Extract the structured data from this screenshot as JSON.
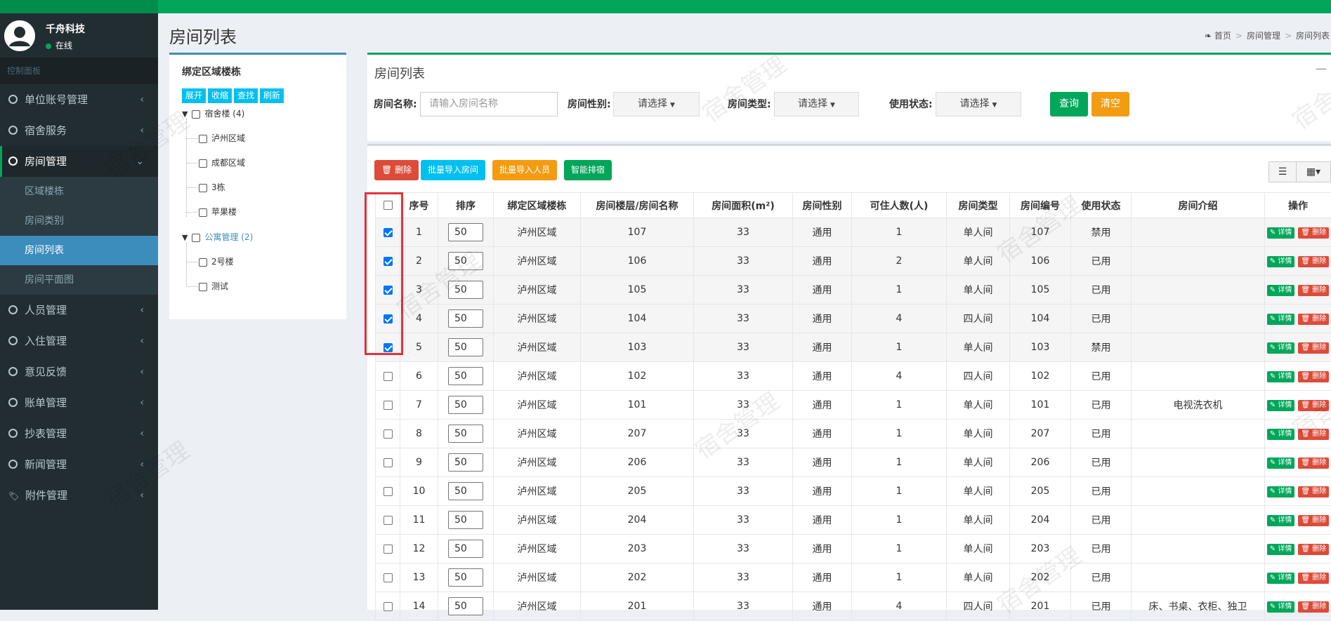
{
  "app": {
    "user_name": "千舟科技",
    "user_status": "在线"
  },
  "sidebar": {
    "header": "控制面板",
    "items": [
      {
        "label": "单位账号管理",
        "icon": "circle-icon",
        "active": false
      },
      {
        "label": "宿舍服务",
        "icon": "circle-icon",
        "active": false
      },
      {
        "label": "房间管理",
        "icon": "circle-icon",
        "active": true
      }
    ],
    "sub_items": [
      {
        "label": "区域楼栋",
        "active": false
      },
      {
        "label": "房间类别",
        "active": false
      },
      {
        "label": "房间列表",
        "active": true
      },
      {
        "label": "房间平面图",
        "active": false
      }
    ],
    "items_after": [
      {
        "label": "人员管理",
        "icon": "circle-icon"
      },
      {
        "label": "入住管理",
        "icon": "circle-icon"
      },
      {
        "label": "意见反馈",
        "icon": "circle-icon"
      },
      {
        "label": "账单管理",
        "icon": "circle-icon"
      },
      {
        "label": "抄表管理",
        "icon": "circle-icon"
      },
      {
        "label": "新闻管理",
        "icon": "circle-icon"
      },
      {
        "label": "附件管理",
        "icon": "tags-icon"
      }
    ]
  },
  "page": {
    "title": "房间列表"
  },
  "breadcrumb": {
    "home": "首页",
    "level1": "房间管理",
    "level2": "房间列表"
  },
  "tree": {
    "title": "绑定区域楼栋",
    "buttons": [
      "展开",
      "收缩",
      "查找",
      "刷新"
    ],
    "root1": "宿舍楼 (4)",
    "root1_children": [
      "泸州区域",
      "成都区域",
      "3栋",
      "苹果楼"
    ],
    "root2": "公寓管理 (2)",
    "root2_children": [
      "2号楼",
      "测试"
    ]
  },
  "filter": {
    "title": "房间列表",
    "name_label": "房间名称:",
    "name_placeholder": "请输入房间名称",
    "gender_label": "房间性别:",
    "type_label": "房间类型:",
    "status_label": "使用状态:",
    "select_placeholder": "请选择",
    "query_btn": "查询",
    "clear_btn": "清空"
  },
  "toolbar": {
    "delete_btn": "删除",
    "import_rooms_btn": "批量导入房间",
    "import_people_btn": "批量导入人员",
    "smart_btn": "智能排宿"
  },
  "table": {
    "headers": [
      "",
      "序号",
      "排序",
      "绑定区域楼栋",
      "房间楼层/房间名称",
      "房间面积(m²)",
      "房间性别",
      "可住人数(人)",
      "房间类型",
      "房间编号",
      "使用状态",
      "房间介绍",
      "操作"
    ],
    "detail_label": "详情",
    "delete_label": "删除",
    "rows": [
      {
        "checked": true,
        "no": "1",
        "sort": "50",
        "area": "泸州区域",
        "name": "107",
        "size": "33",
        "gender": "通用",
        "capacity": "1",
        "type": "单人间",
        "code": "107",
        "status": "禁用",
        "intro": ""
      },
      {
        "checked": true,
        "no": "2",
        "sort": "50",
        "area": "泸州区域",
        "name": "106",
        "size": "33",
        "gender": "通用",
        "capacity": "2",
        "type": "单人间",
        "code": "106",
        "status": "已用",
        "intro": ""
      },
      {
        "checked": true,
        "no": "3",
        "sort": "50",
        "area": "泸州区域",
        "name": "105",
        "size": "33",
        "gender": "通用",
        "capacity": "1",
        "type": "单人间",
        "code": "105",
        "status": "已用",
        "intro": ""
      },
      {
        "checked": true,
        "no": "4",
        "sort": "50",
        "area": "泸州区域",
        "name": "104",
        "size": "33",
        "gender": "通用",
        "capacity": "4",
        "type": "四人间",
        "code": "104",
        "status": "已用",
        "intro": ""
      },
      {
        "checked": true,
        "no": "5",
        "sort": "50",
        "area": "泸州区域",
        "name": "103",
        "size": "33",
        "gender": "通用",
        "capacity": "1",
        "type": "单人间",
        "code": "103",
        "status": "禁用",
        "intro": ""
      },
      {
        "checked": false,
        "no": "6",
        "sort": "50",
        "area": "泸州区域",
        "name": "102",
        "size": "33",
        "gender": "通用",
        "capacity": "4",
        "type": "四人间",
        "code": "102",
        "status": "已用",
        "intro": ""
      },
      {
        "checked": false,
        "no": "7",
        "sort": "50",
        "area": "泸州区域",
        "name": "101",
        "size": "33",
        "gender": "通用",
        "capacity": "1",
        "type": "单人间",
        "code": "101",
        "status": "已用",
        "intro": "电视洗衣机"
      },
      {
        "checked": false,
        "no": "8",
        "sort": "50",
        "area": "泸州区域",
        "name": "207",
        "size": "33",
        "gender": "通用",
        "capacity": "1",
        "type": "单人间",
        "code": "207",
        "status": "已用",
        "intro": ""
      },
      {
        "checked": false,
        "no": "9",
        "sort": "50",
        "area": "泸州区域",
        "name": "206",
        "size": "33",
        "gender": "通用",
        "capacity": "1",
        "type": "单人间",
        "code": "206",
        "status": "已用",
        "intro": ""
      },
      {
        "checked": false,
        "no": "10",
        "sort": "50",
        "area": "泸州区域",
        "name": "205",
        "size": "33",
        "gender": "通用",
        "capacity": "1",
        "type": "单人间",
        "code": "205",
        "status": "已用",
        "intro": ""
      },
      {
        "checked": false,
        "no": "11",
        "sort": "50",
        "area": "泸州区域",
        "name": "204",
        "size": "33",
        "gender": "通用",
        "capacity": "1",
        "type": "单人间",
        "code": "204",
        "status": "已用",
        "intro": ""
      },
      {
        "checked": false,
        "no": "12",
        "sort": "50",
        "area": "泸州区域",
        "name": "203",
        "size": "33",
        "gender": "通用",
        "capacity": "1",
        "type": "单人间",
        "code": "203",
        "status": "已用",
        "intro": ""
      },
      {
        "checked": false,
        "no": "13",
        "sort": "50",
        "area": "泸州区域",
        "name": "202",
        "size": "33",
        "gender": "通用",
        "capacity": "1",
        "type": "单人间",
        "code": "202",
        "status": "已用",
        "intro": ""
      },
      {
        "checked": false,
        "no": "14",
        "sort": "50",
        "area": "泸州区域",
        "name": "201",
        "size": "33",
        "gender": "通用",
        "capacity": "4",
        "type": "四人间",
        "code": "201",
        "status": "已用",
        "intro": "床、书桌、衣柜、独卫"
      }
    ]
  },
  "watermark": "宿舍管理",
  "colors": {
    "primary_green": "#00a65a",
    "sidebar_bg": "#222d32",
    "active_blue": "#3c8dbc",
    "danger": "#dd4b39",
    "warning": "#f39c12",
    "info": "#00c0ef"
  }
}
